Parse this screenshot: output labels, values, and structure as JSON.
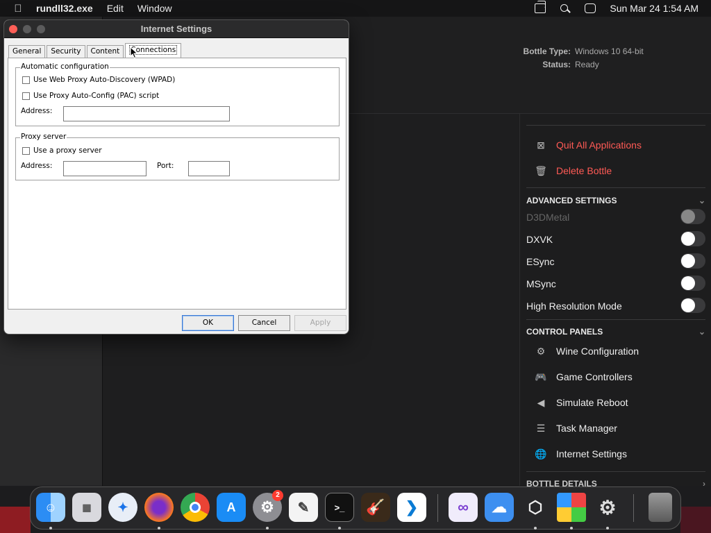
{
  "menubar": {
    "app_name": "rundll32.exe",
    "items": [
      "Edit",
      "Window"
    ],
    "datetime": "Sun Mar 24  1:54 AM"
  },
  "bottle_info": {
    "type_label": "Bottle Type:",
    "type_value": "Windows 10 64-bit",
    "status_label": "Status:",
    "status_value": "Ready"
  },
  "right_pane": {
    "quit_all": "Quit All Applications",
    "delete_bottle": "Delete Bottle",
    "advanced_header": "ADVANCED SETTINGS",
    "advanced": [
      {
        "label": "D3DMetal",
        "on": false,
        "disabled": true
      },
      {
        "label": "DXVK",
        "on": false,
        "disabled": false
      },
      {
        "label": "ESync",
        "on": false,
        "disabled": false
      },
      {
        "label": "MSync",
        "on": false,
        "disabled": false
      },
      {
        "label": "High Resolution Mode",
        "on": false,
        "disabled": false
      }
    ],
    "control_header": "CONTROL PANELS",
    "control_panels": [
      {
        "label": "Wine Configuration",
        "icon": "gear-icon"
      },
      {
        "label": "Game Controllers",
        "icon": "gamepad-icon"
      },
      {
        "label": "Simulate Reboot",
        "icon": "reboot-icon"
      },
      {
        "label": "Task Manager",
        "icon": "list-icon"
      },
      {
        "label": "Internet Settings",
        "icon": "globe-icon"
      }
    ],
    "bottle_details_header": "BOTTLE DETAILS"
  },
  "dialog": {
    "title": "Internet Settings",
    "tabs": [
      "General",
      "Security",
      "Content",
      "Connections"
    ],
    "active_tab": "Connections",
    "auto_config": {
      "legend": "Automatic configuration",
      "wpad_label": "Use Web Proxy Auto-Discovery (WPAD)",
      "wpad_checked": false,
      "pac_label": "Use Proxy Auto-Config (PAC) script",
      "pac_checked": false,
      "address_label": "Address:",
      "address_value": ""
    },
    "proxy": {
      "legend": "Proxy server",
      "use_proxy_label": "Use a proxy server",
      "use_proxy_checked": false,
      "address_label": "Address:",
      "address_value": "",
      "port_label": "Port:",
      "port_value": ""
    },
    "buttons": {
      "ok": "OK",
      "cancel": "Cancel",
      "apply": "Apply"
    }
  },
  "dock": {
    "apps": [
      "Finder",
      "Launchpad",
      "Safari",
      "Firefox",
      "Chrome",
      "App Store",
      "System Settings",
      "TextEdit",
      "Terminal",
      "GarageBand",
      "Visual Studio Code",
      "Visual Studio",
      "Weather",
      "Whisky",
      "Windows",
      "Wine",
      "Trash"
    ],
    "system_settings_badge": "2"
  }
}
